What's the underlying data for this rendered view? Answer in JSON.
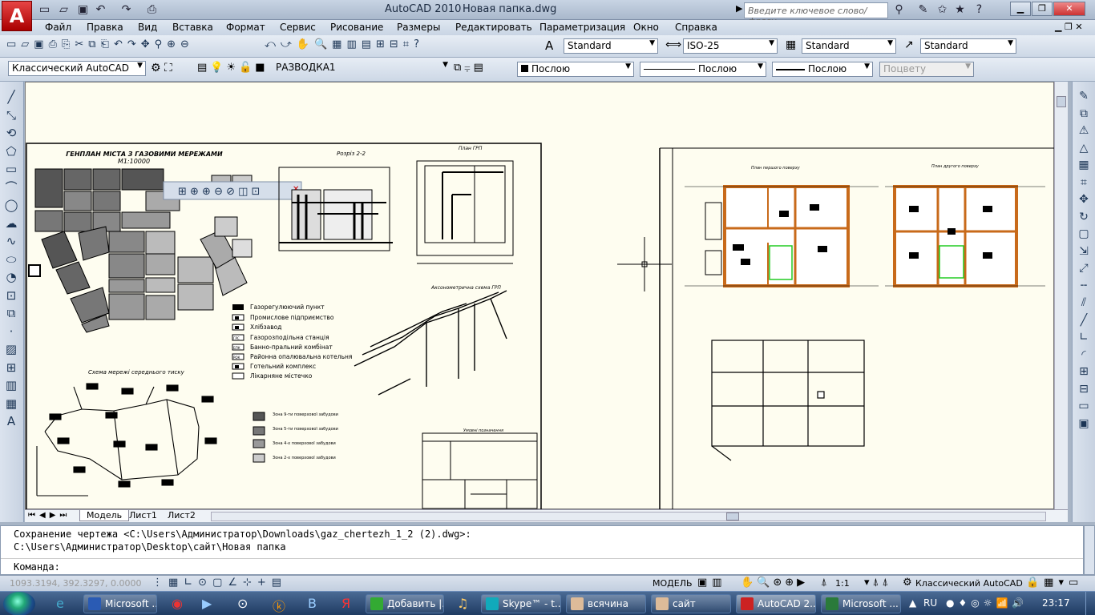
{
  "window": {
    "app_title": "AutoCAD 2010",
    "doc_title": "Новая папка.dwg",
    "search_placeholder": "Введите ключевое слово/фразу"
  },
  "menu": [
    "Файл",
    "Правка",
    "Вид",
    "Вставка",
    "Формат",
    "Сервис",
    "Рисование",
    "Размеры",
    "Редактировать",
    "Параметризация",
    "Окно",
    "Справка"
  ],
  "styles": {
    "text_style": "Standard",
    "dim_style": "ISO-25",
    "table_style": "Standard",
    "multileader_style": "Standard"
  },
  "layers": {
    "workspace": "Классический AutoCAD",
    "layer": "РАЗВОДКА1",
    "color": "Послою",
    "linetype": "Послою",
    "lineweight": "Послою",
    "plotstyle": "Поцвету"
  },
  "drawing": {
    "genplan_title": "ГЕНПЛАН МІСТА З ГАЗОВИМИ МЕРЕЖАМИ",
    "genplan_scale": "М1:10000",
    "section_title": "Розріз 2-2",
    "grp_plan": "План ГРП",
    "axonometric": "Аксонометрична схема ГРП",
    "scheme_title": "Схема мережі середнього тиску",
    "legend": [
      "Газорегулюючий пункт",
      "Промислове підприємство",
      "Хлібзавод",
      "Газорозподільна станція",
      "Банно-пральний комбінат",
      "Районна опалювальна котельня",
      "Готельний комплекс",
      "Лікарняне містечко"
    ],
    "legend_codes": [
      "",
      "",
      "",
      "ГРС",
      "БПК",
      "РОК",
      "",
      ""
    ],
    "zones": [
      "Зона 9-ти поверхової забудови",
      "Зона 5-ти поверхової забудови",
      "Зона 4-х поверхової забудови",
      "Зона 2-х поверхової забудови"
    ],
    "conventions": "Умовні позначення",
    "floor1": "План першого поверху",
    "floor2": "План другого поверху"
  },
  "tabs": [
    "Модель",
    "Лист1",
    "Лист2"
  ],
  "command": {
    "line1": "Сохранение чертежа <C:\\Users\\Администратор\\Downloads\\gaz_chertezh_1_2 (2).dwg>:",
    "line2": "C:\\Users\\Администратор\\Desktop\\сайт\\Новая папка",
    "prompt": "Команда:"
  },
  "status": {
    "coords": "1093.3194, 392.3297, 0.0000",
    "model": "МОДЕЛЬ",
    "scale": "1:1",
    "workspace": "Классический AutoCAD"
  },
  "taskbar": {
    "items": [
      "Microsoft ...",
      "Добавить |...",
      "Skype™ - t...",
      "всячина",
      "сайт",
      "AutoCAD 2...",
      "Microsoft ..."
    ],
    "lang": "RU",
    "time": "23:17"
  },
  "colors": {
    "accent": "#c02020",
    "titlebar": "#b7c5d8",
    "canvas": "#fefdf0",
    "taskbar": "#1f3b62"
  }
}
